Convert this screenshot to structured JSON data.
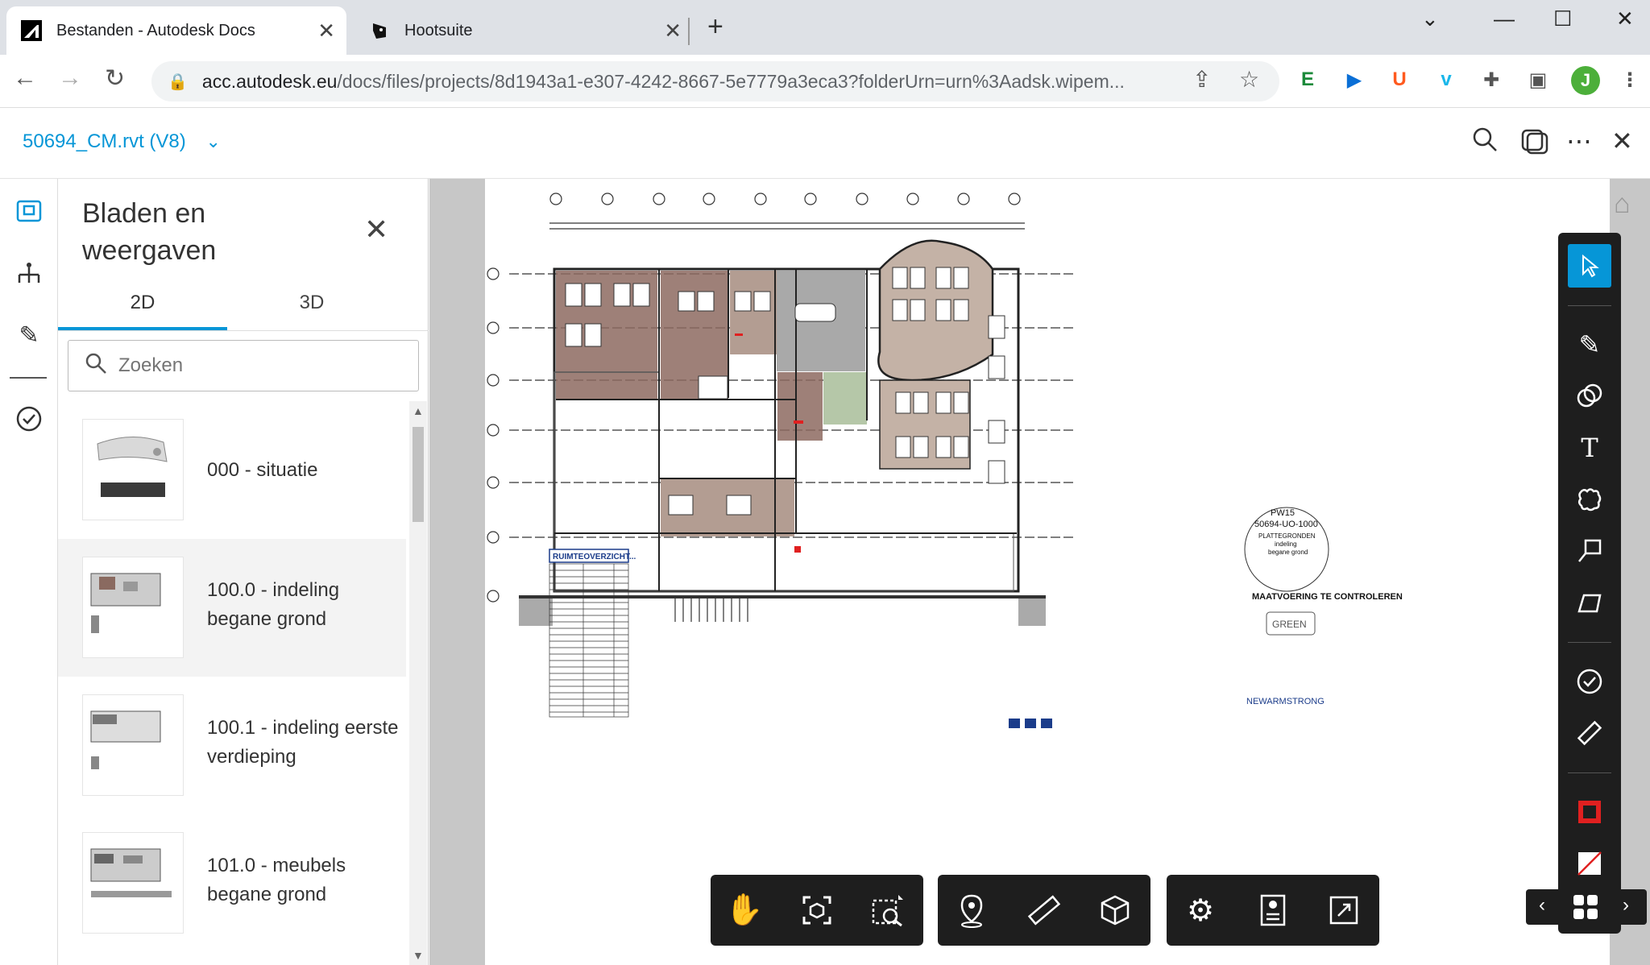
{
  "browser": {
    "tabs": [
      {
        "title": "Bestanden - Autodesk Docs",
        "active": true,
        "icon": "autodesk-icon"
      },
      {
        "title": "Hootsuite",
        "active": false,
        "icon": "hootsuite-owl-icon"
      }
    ],
    "new_tab": "+",
    "url_host": "acc.autodesk.eu",
    "url_path": "/docs/files/projects/8d1943a1-e307-4242-8667-5e7779a3eca3?folderUrn=urn%3Aadsk.wipem...",
    "profile_initial": "J",
    "extensions": [
      "E",
      "▶",
      "U",
      "v"
    ]
  },
  "app": {
    "file_name": "50694_CM.rvt",
    "file_version": "(V8)"
  },
  "panel": {
    "title": "Bladen en weergaven",
    "tabs": [
      "2D",
      "3D"
    ],
    "search_placeholder": "Zoeken",
    "sheets": [
      {
        "label": "000 - situatie"
      },
      {
        "label": "100.0 - indeling begane grond",
        "selected": true
      },
      {
        "label": "100.1 - indeling eerste verdieping"
      },
      {
        "label": "101.0 - meubels begane grond"
      }
    ]
  },
  "drawing": {
    "schedule_title": "RUIMTEOVERZICHT...",
    "stamp_line1": "PW15",
    "stamp_line2": "50694-UO-1000",
    "stamp_line3": "PLATTEGRONDEN",
    "stamp_line4": "indeling",
    "stamp_line5": "begane grond",
    "note_title": "MAATVOERING TE CONTROLEREN",
    "brand": "NEWARMSTRONG",
    "green_badge": "GREEN"
  },
  "colors": {
    "accent": "#0696d7",
    "toolbar_bg": "#1e1e1e",
    "markup_red": "#e02020"
  }
}
